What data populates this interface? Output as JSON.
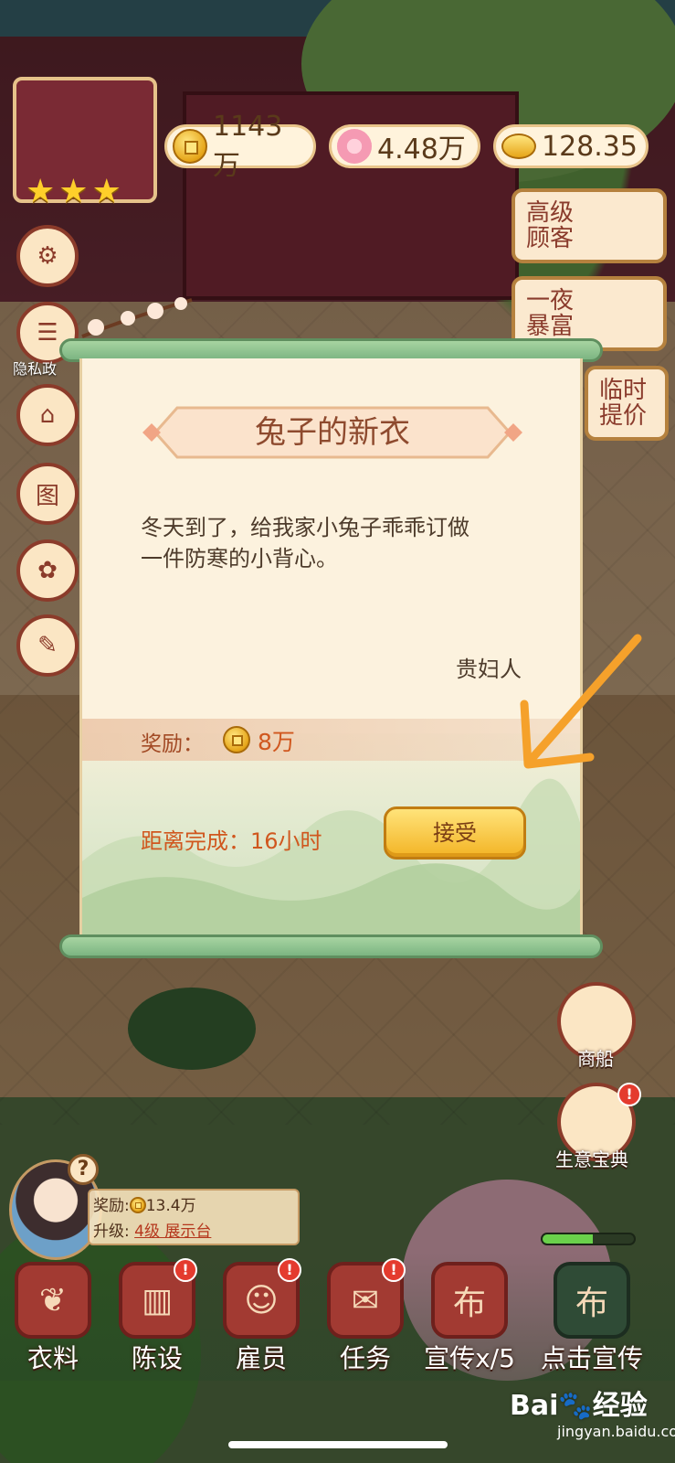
{
  "currencies": [
    {
      "icon": "copper-coin-icon",
      "value": "1143万"
    },
    {
      "icon": "peach-blossom-icon",
      "value": "4.48万"
    },
    {
      "icon": "gold-ingot-icon",
      "value": "128.35"
    }
  ],
  "shop": {
    "stars": 3,
    "star_glyph": "★"
  },
  "side_buttons": [
    {
      "name": "settings-gear-button",
      "icon": "gear-icon",
      "glyph": "⚙",
      "label": ""
    },
    {
      "name": "privacy-button",
      "icon": "document-icon",
      "glyph": "☰",
      "label": "隐私政"
    },
    {
      "name": "upgrade-button",
      "icon": "house-arrow-icon",
      "glyph": "⌂",
      "label": ""
    },
    {
      "name": "map-button",
      "icon": "picture-icon",
      "glyph": "图",
      "label": ""
    },
    {
      "name": "lucky-bag-button",
      "icon": "bag-icon",
      "glyph": "✿",
      "label": ""
    },
    {
      "name": "paint-button",
      "icon": "brush-icon",
      "glyph": "✎",
      "label": ""
    }
  ],
  "right_cards": [
    {
      "name": "vip-customer-card",
      "text": "高级顾客"
    },
    {
      "name": "overnight-rich-card",
      "text": "一夜暴富"
    },
    {
      "name": "temp-bid-card",
      "text": "临时提价"
    }
  ],
  "order_dialog": {
    "title": "兔子的新衣",
    "description": "冬天到了，给我家小兔子乖乖订做\n一件防寒的小背心。",
    "sender": "贵妇人",
    "reward_label": "奖励：",
    "reward_value": "8万",
    "countdown_label": "距离完成：16小时",
    "accept_label": "接受"
  },
  "employee_info": {
    "reward_label": "奖励:",
    "reward_value": "13.4万",
    "upgrade_label": "升级:",
    "upgrade_link": "4级 展示台",
    "help_glyph": "?"
  },
  "right_round": [
    {
      "name": "merchant-ship-button",
      "label": "商船"
    },
    {
      "name": "business-guide-button",
      "label": "生意宝典"
    }
  ],
  "progress": {
    "fraction": 0.55,
    "color": "#6ad14b"
  },
  "bottom_nav": [
    {
      "name": "nav-fabric",
      "label": "衣料",
      "icon": "scroll-icon",
      "glyph": "❦",
      "alert": false
    },
    {
      "name": "nav-furnishing",
      "label": "陈设",
      "icon": "cabinet-icon",
      "glyph": "▥",
      "alert": true
    },
    {
      "name": "nav-employees",
      "label": "雇员",
      "icon": "person-icon",
      "glyph": "☺",
      "alert": true
    },
    {
      "name": "nav-tasks",
      "label": "任务",
      "icon": "task-scroll-icon",
      "glyph": "✉",
      "alert": true
    },
    {
      "name": "nav-promote",
      "label": "宣传x/5",
      "icon": "poster-icon",
      "glyph": "布",
      "alert": false
    },
    {
      "name": "nav-click-promote",
      "label": "点击宣传",
      "icon": "banner-icon",
      "glyph": "布",
      "alert": false
    }
  ],
  "alert_glyph": "!",
  "watermark": {
    "brand": "Bai",
    "brand2": "经验",
    "sub": "jingyan.baidu.com"
  },
  "colors": {
    "accent_orange": "#f5a12b",
    "title_brown": "#8e4a2e",
    "reward_orange": "#d0571e"
  }
}
